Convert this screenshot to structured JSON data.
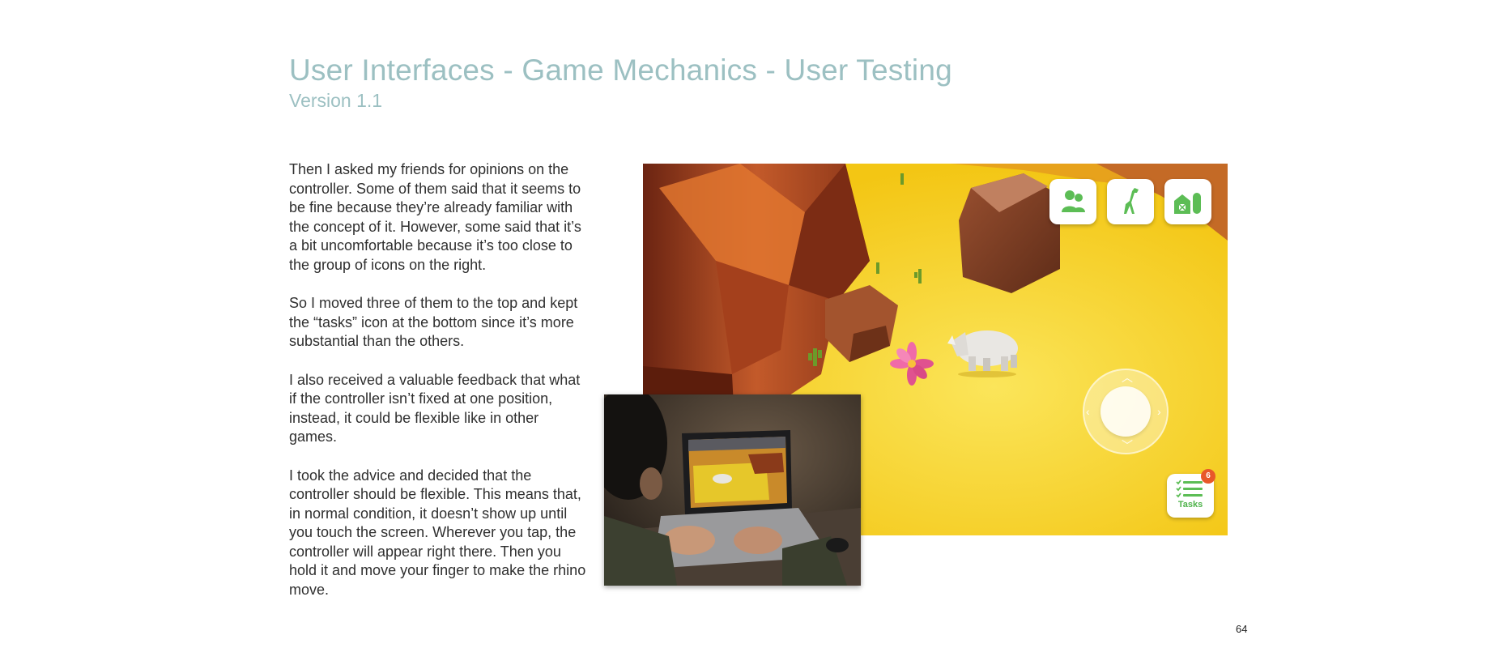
{
  "header": {
    "title": "User Interfaces - Game Mechanics - User Testing",
    "version": "Version 1.1"
  },
  "body": {
    "paragraphs": [
      "Then I asked my friends for opinions on the controller. Some of them said that it seems to be fine because they’re already familiar with the concept of it. However, some said that it’s a bit uncomfortable because it’s too close to the group of icons on the right.",
      "So I moved three of them to the top and kept the “tasks” icon at the bottom since it’s more substantial than the others.",
      "I also received a valuable feedback that what if the controller isn’t fixed at one position, instead, it could be flexible like in other games.",
      "I took the advice and decided that the controller should be flexible. This means that, in normal condition, it doesn’t show up until you touch the screen. Wherever you tap, the controller will appear right there. Then you hold it and move your finger to make the rhino move."
    ]
  },
  "game": {
    "hud_icons": [
      "friends-icon",
      "giraffe-icon",
      "farm-icon"
    ],
    "tasks_label": "Tasks",
    "tasks_badge": "6",
    "accent_color": "#5cbd55",
    "badge_color": "#e8582a"
  },
  "page_number": "64",
  "colors": {
    "title": "#9cc0c2",
    "text": "#2f2f2f",
    "ground": "#f5d21a",
    "rock": "#b8502a"
  }
}
